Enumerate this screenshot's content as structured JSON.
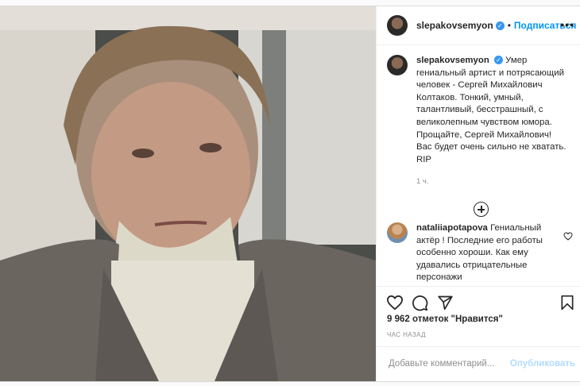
{
  "post": {
    "username": "slepakovsemyon",
    "verified_mark": "✓",
    "separator": "•",
    "follow_label": "Подписаться",
    "more_label": "•••",
    "caption_text": "Умер гениальный артист и потрясающий человек - Сергей Михайлович Колтаков. Тонкий, умный, талантливый, бесстрашный, с великолепным чувством юмора. Прощайте, Сергей Михайлович! Вас будет очень сильно не хватать. RIP",
    "time": "1 ч.",
    "comment": {
      "username": "nataliiapotapova",
      "text": "Гениальный актёр ! Последние его работы особенно хороши. Как ему удавались отрицательные персонажи"
    },
    "likes": "9 962 отметок \"Нравится\"",
    "ago": "ЧАС НАЗАД",
    "add_comment_placeholder": "Добавьте комментарий...",
    "publish_label": "Опубликовать"
  },
  "icons": {
    "avatar": "avatar",
    "verified": "verified-badge-icon",
    "heart": "heart-icon",
    "comment": "comment-icon",
    "share": "share-icon",
    "bookmark": "bookmark-icon",
    "load_more": "plus-circle-icon"
  },
  "colors": {
    "accent": "#0095f6",
    "verified": "#3897f0",
    "publish_disabled": "#b3dbff"
  }
}
